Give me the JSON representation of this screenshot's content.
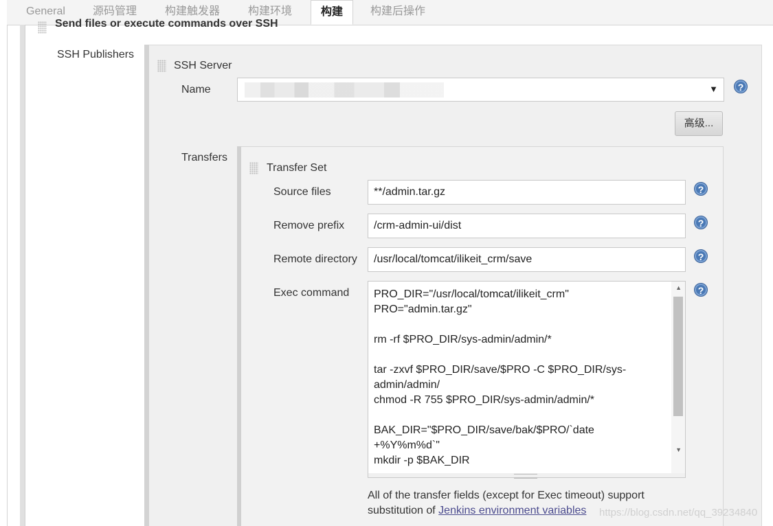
{
  "tabs": [
    "General",
    "源码管理",
    "构建触发器",
    "构建环境",
    "构建",
    "构建后操作"
  ],
  "active_tab": "构建",
  "section": {
    "title": "Send files or execute commands over SSH"
  },
  "publishers_label": "SSH Publishers",
  "server": {
    "title": "SSH Server",
    "name_label": "Name",
    "name_value": "",
    "advanced_label": "高级..."
  },
  "transfers_label": "Transfers",
  "transfer_set": {
    "title": "Transfer Set",
    "source_files_label": "Source files",
    "source_files_value": "**/admin.tar.gz",
    "remove_prefix_label": "Remove prefix",
    "remove_prefix_value": "/crm-admin-ui/dist",
    "remote_dir_label": "Remote directory",
    "remote_dir_value": "/usr/local/tomcat/ilikeit_crm/save",
    "exec_label": "Exec command",
    "exec_lines": [
      "PRO_DIR=\"/usr/local/tomcat/ilikeit_crm\"",
      "PRO=\"admin.tar.gz\"",
      "",
      "rm -rf $PRO_DIR/sys-admin/admin/*",
      "",
      "tar -zxvf  $PRO_DIR/save/$PRO -C $PRO_DIR/sys-",
      "admin/admin/",
      "chmod -R 755 $PRO_DIR/sys-admin/admin/*",
      "",
      "BAK_DIR=\"$PRO_DIR/save/bak/$PRO/`date",
      "+%Y%m%d`\"",
      "mkdir -p $BAK_DIR"
    ]
  },
  "note": {
    "line1": "All of the transfer fields (except for Exec timeout) support",
    "line2_prefix": "substitution of ",
    "link": "Jenkins environment variables"
  },
  "watermark": "https://blog.csdn.net/qq_39234840",
  "icons": {
    "help": "?",
    "select_arrow": "▼",
    "scroll_up": "▲",
    "scroll_down": "▼"
  },
  "colors": {
    "help_blue": "#4a79b5",
    "link": "#4b4b8e",
    "panel_bg": "#f0f0f0"
  }
}
